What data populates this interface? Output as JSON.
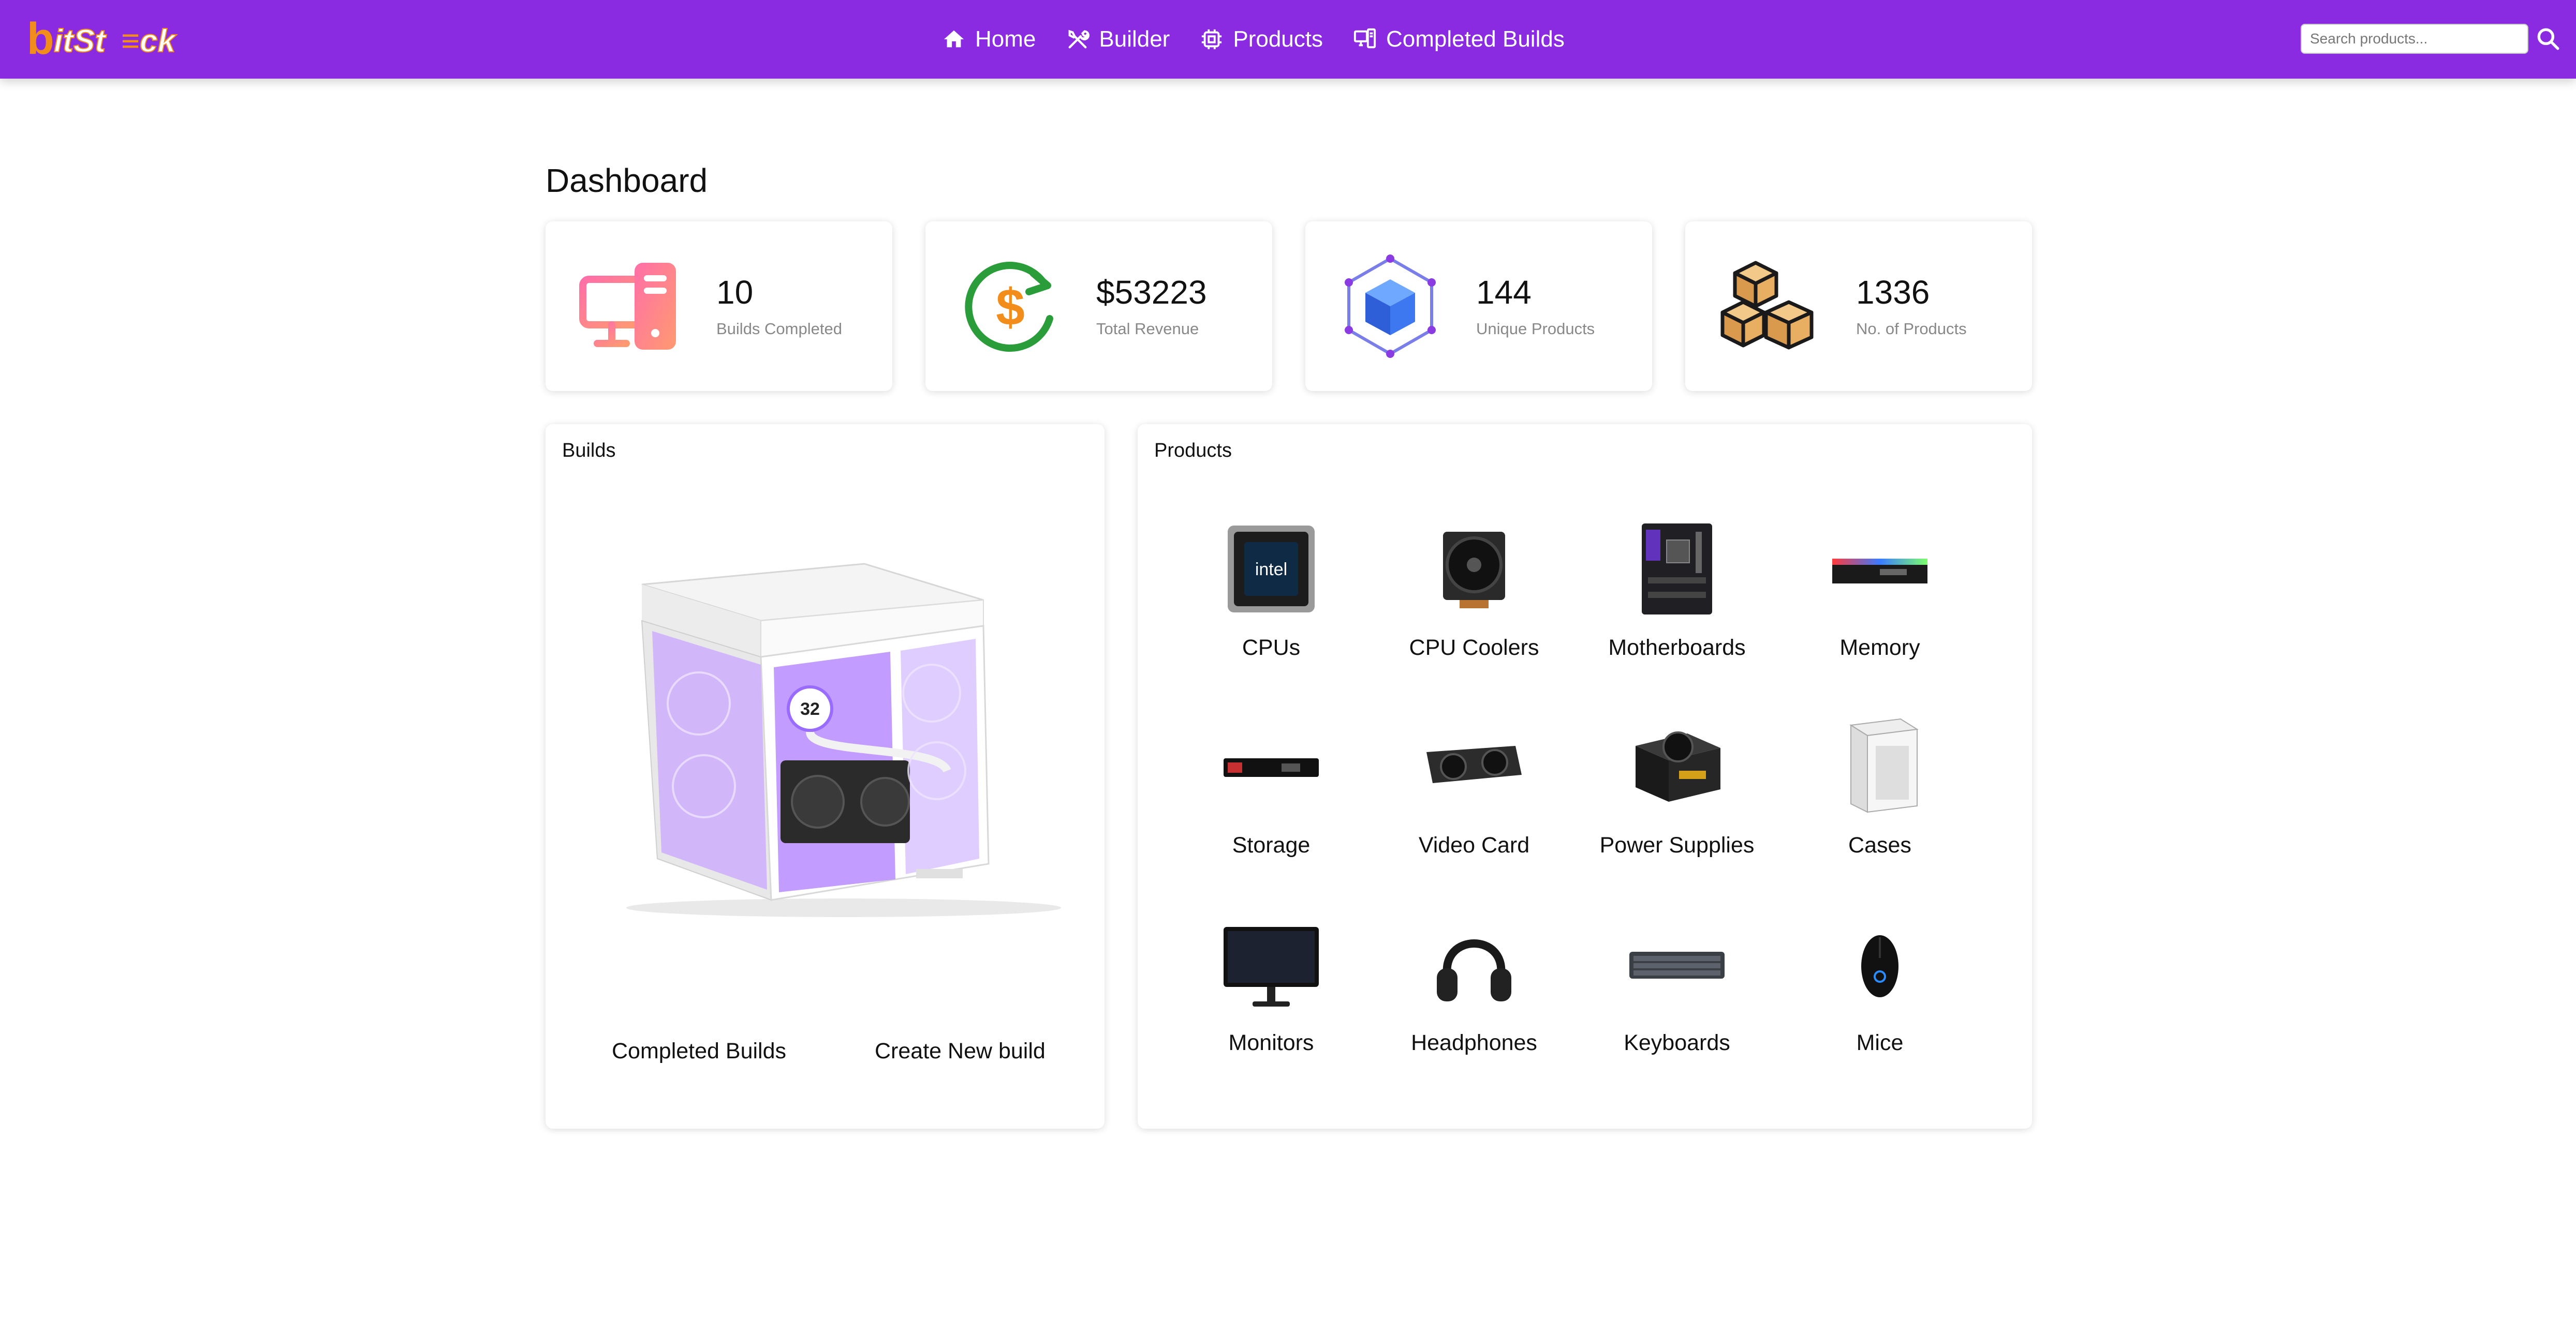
{
  "brand": {
    "name": "bitStack",
    "color": "#8a2be2",
    "logo_orange": "#f28c1b"
  },
  "nav": {
    "items": [
      {
        "label": "Home",
        "icon": "home-icon"
      },
      {
        "label": "Builder",
        "icon": "tools-icon"
      },
      {
        "label": "Products",
        "icon": "chip-icon"
      },
      {
        "label": "Completed Builds",
        "icon": "pc-icon"
      }
    ]
  },
  "search": {
    "placeholder": "Search products...",
    "value": ""
  },
  "dashboard": {
    "title": "Dashboard",
    "stats": [
      {
        "value": "10",
        "label": "Builds Completed",
        "icon": "computer-icon"
      },
      {
        "value": "$53223",
        "label": "Total Revenue",
        "icon": "dollar-cycle-icon"
      },
      {
        "value": "144",
        "label": "Unique Products",
        "icon": "cube-network-icon"
      },
      {
        "value": "1336",
        "label": "No. of Products",
        "icon": "boxes-icon"
      }
    ]
  },
  "builds": {
    "title": "Builds",
    "image": "white-pc-case-image",
    "links": [
      "Completed Builds",
      "Create New build"
    ]
  },
  "products": {
    "title": "Products",
    "categories": [
      {
        "label": "CPUs",
        "icon": "cpu-image"
      },
      {
        "label": "CPU Coolers",
        "icon": "cpu-cooler-image"
      },
      {
        "label": "Motherboards",
        "icon": "motherboard-image"
      },
      {
        "label": "Memory",
        "icon": "memory-image"
      },
      {
        "label": "Storage",
        "icon": "ssd-image"
      },
      {
        "label": "Video Card",
        "icon": "gpu-image"
      },
      {
        "label": "Power Supplies",
        "icon": "psu-image"
      },
      {
        "label": "Cases",
        "icon": "case-image"
      },
      {
        "label": "Monitors",
        "icon": "monitor-image"
      },
      {
        "label": "Headphones",
        "icon": "headphones-image"
      },
      {
        "label": "Keyboards",
        "icon": "keyboard-image"
      },
      {
        "label": "Mice",
        "icon": "mouse-image"
      }
    ]
  }
}
